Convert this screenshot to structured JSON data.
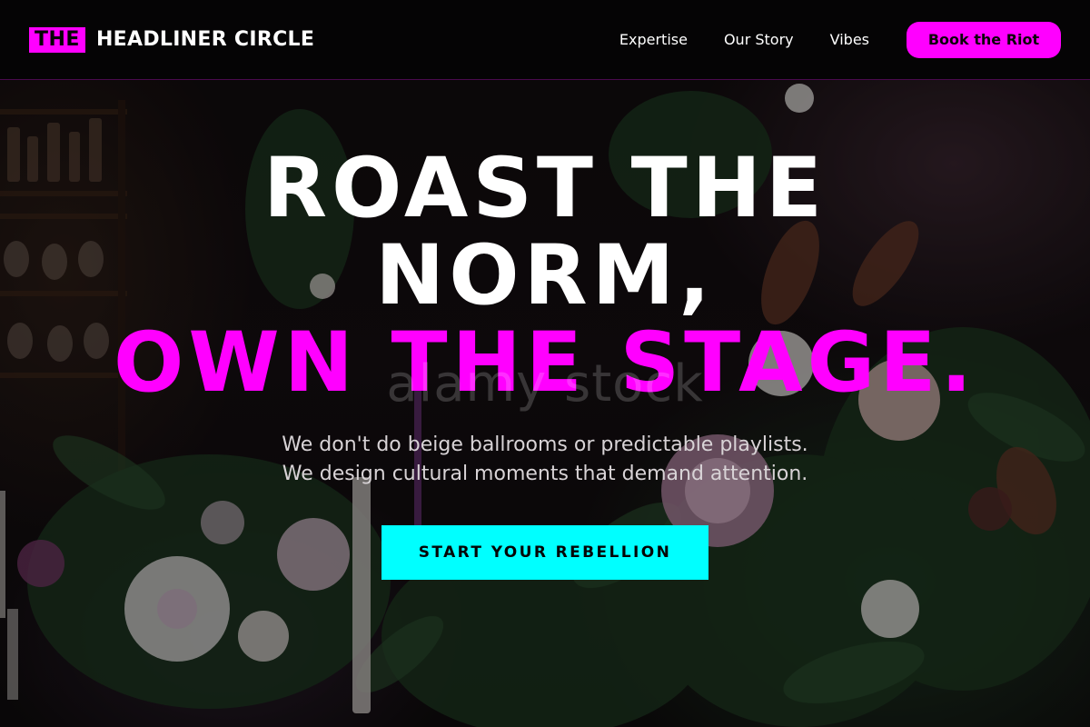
{
  "header": {
    "logo": {
      "mark": "THE",
      "name": "HEADLINER CIRCLE"
    },
    "nav": [
      {
        "label": "Expertise"
      },
      {
        "label": "Our Story"
      },
      {
        "label": "Vibes"
      }
    ],
    "cta_label": "Book the Riot"
  },
  "hero": {
    "headline_line1": "ROAST THE",
    "headline_line2": "NORM,",
    "headline_line3": "OWN THE STAGE.",
    "watermark": "alamy stock",
    "subtext_line1": "We don't do beige ballrooms or predictable playlists.",
    "subtext_line2": "We design cultural moments that demand attention.",
    "button_label": "START YOUR REBELLION"
  },
  "colors": {
    "magenta": "#ff00ff",
    "cyan": "#00ffff",
    "header_bg": "#050405"
  }
}
